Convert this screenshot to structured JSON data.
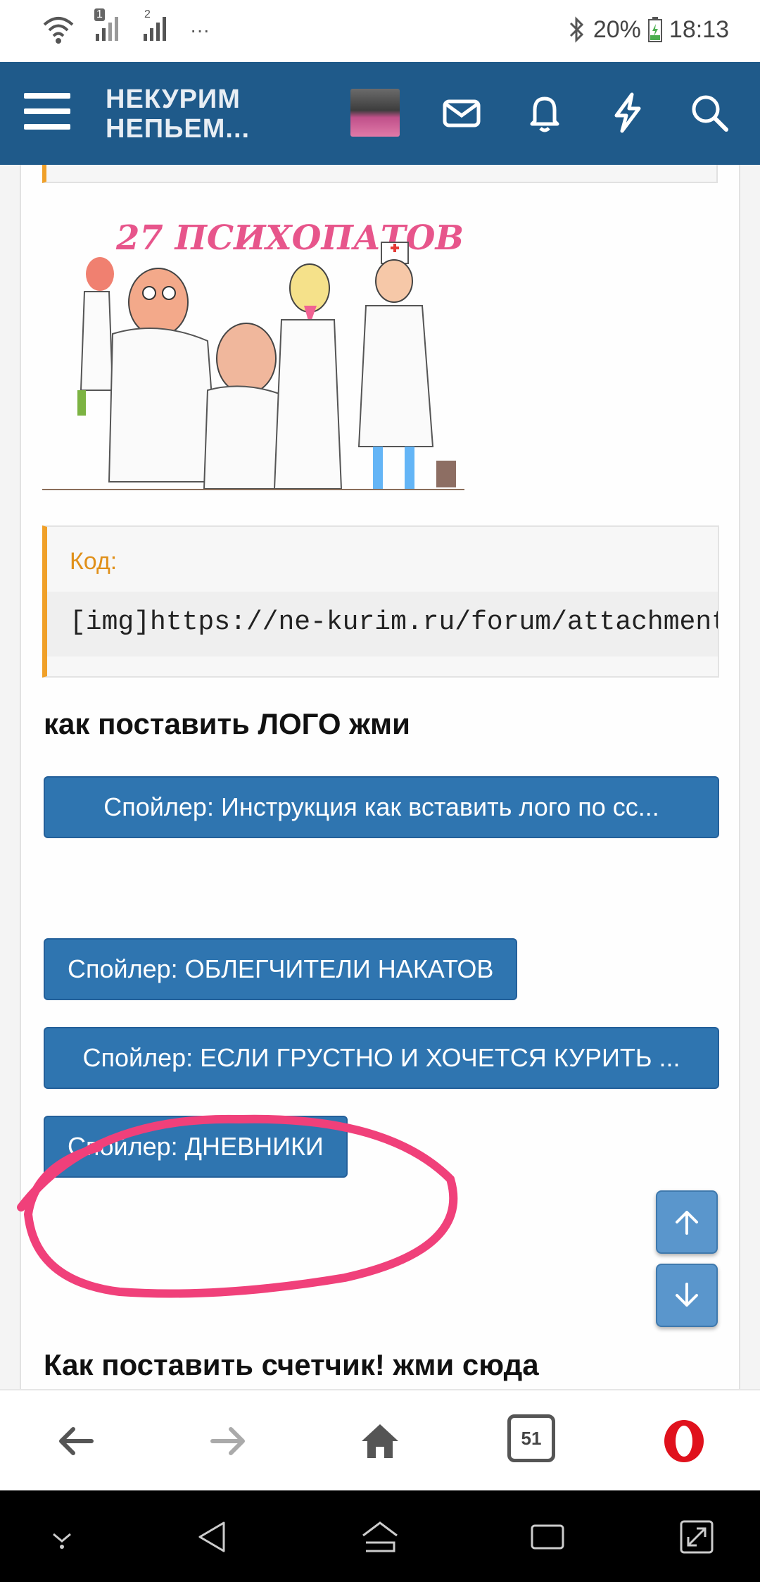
{
  "status_bar": {
    "sim1": "1",
    "sim2": "2",
    "more": "···",
    "battery": "20%",
    "time": "18:13"
  },
  "app_bar": {
    "title_line1": "НЕКУРИМ",
    "title_line2": "НЕПЬЕМ...",
    "icons": [
      "menu-icon",
      "avatar",
      "mail-icon",
      "bell-icon",
      "lightning-icon",
      "search-icon"
    ]
  },
  "post": {
    "image_caption": "27 ПСИХОПАТОВ",
    "code_block": {
      "title": "Код:",
      "text": "[img]https://ne-kurim.ru/forum/attachments/"
    },
    "heading_logo": "как поставить ЛОГО жми",
    "spoiler_logo": "Спойлер: Инструкция как вставить лого по сс...",
    "spoiler_relief": "Спойлер: ОБЛЕГЧИТЕЛИ НАКАТОВ",
    "spoiler_sad": "Спойлер: ЕСЛИ ГРУСТНО И ХОЧЕТСЯ КУРИТЬ ...",
    "spoiler_diaries": "Спойлер: ДНЕВНИКИ",
    "heading_counter": "Как поставить счетчик! жми сюда"
  },
  "browser_bar": {
    "tabs_count": "51",
    "icons": [
      "back-icon",
      "forward-icon",
      "home-icon",
      "tabs-icon",
      "opera-icon"
    ]
  },
  "colors": {
    "app_bar": "#1f5a8a",
    "spoiler_button": "#2f75b0",
    "code_accent": "#f0a028",
    "circle_annotation": "#f0407a",
    "opera_red": "#e0111c"
  }
}
